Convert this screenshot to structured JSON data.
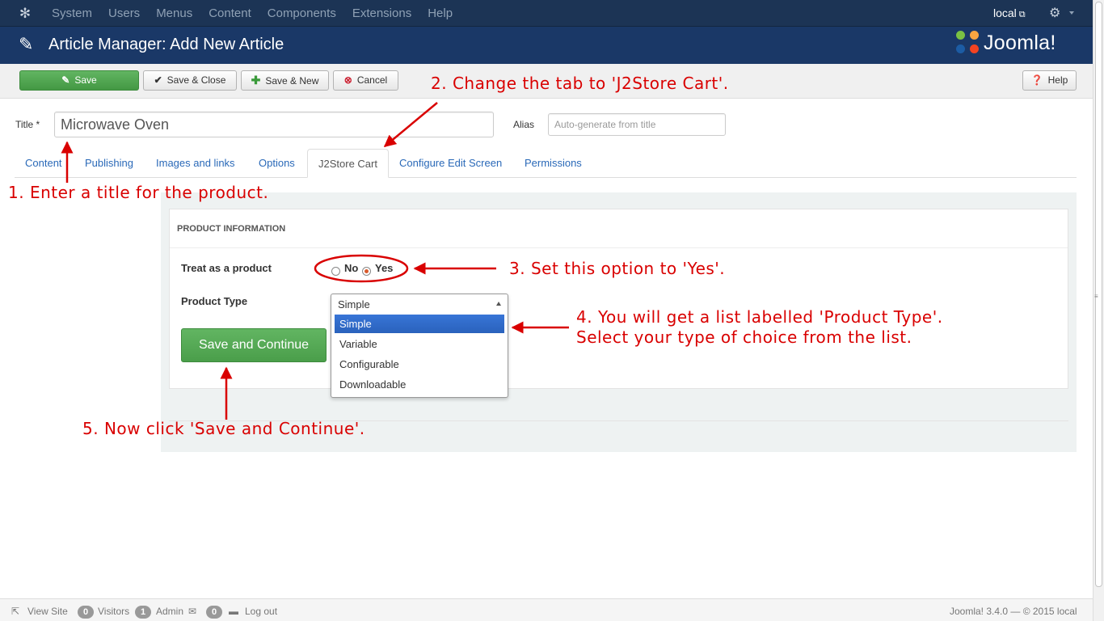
{
  "topnav": {
    "menu": [
      "System",
      "Users",
      "Menus",
      "Content",
      "Components",
      "Extensions",
      "Help"
    ],
    "user": "local"
  },
  "header": {
    "title": "Article Manager: Add New Article",
    "brand": "Joomla!"
  },
  "toolbar": {
    "save": "Save",
    "save_close": "Save & Close",
    "save_new": "Save & New",
    "cancel": "Cancel",
    "help": "Help"
  },
  "form": {
    "title_label": "Title *",
    "title_value": "Microwave Oven",
    "alias_label": "Alias",
    "alias_placeholder": "Auto-generate from title"
  },
  "tabs": [
    "Content",
    "Publishing",
    "Images and links",
    "Options",
    "J2Store Cart",
    "Configure Edit Screen",
    "Permissions"
  ],
  "active_tab": "J2Store Cart",
  "product": {
    "heading": "PRODUCT INFORMATION",
    "treat_label": "Treat as a product",
    "no_label": "No",
    "yes_label": "Yes",
    "selected": "Yes",
    "type_label": "Product Type",
    "type_value": "Simple",
    "type_options": [
      "Simple",
      "Variable",
      "Configurable",
      "Downloadable"
    ],
    "continue_label": "Save and Continue"
  },
  "annotations": {
    "step1": "1. Enter a title for the product.",
    "step2": "2. Change the tab to 'J2Store Cart'.",
    "step3": "3. Set this option to 'Yes'.",
    "step4_line1": "4. You will get a list labelled 'Product Type'.",
    "step4_line2": "Select your type of choice from the list.",
    "step5": "5. Now click 'Save and Continue'.",
    "color": "#d90000"
  },
  "statusbar": {
    "view_site": "View Site",
    "visitors_count": "0",
    "visitors": "Visitors",
    "admin_count": "1",
    "admin": "Admin",
    "messages_count": "0",
    "logout": "Log out",
    "version": "Joomla! 3.4.0 — © 2015 local"
  }
}
